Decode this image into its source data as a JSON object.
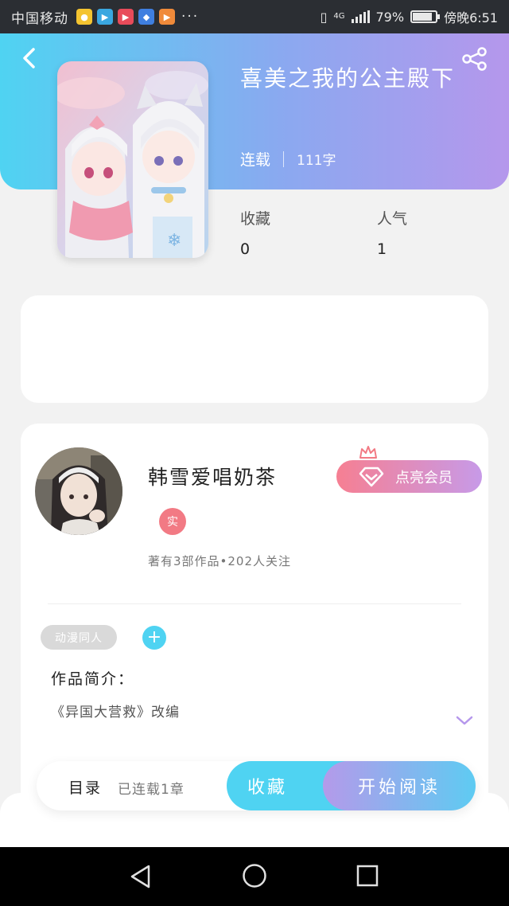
{
  "status_bar": {
    "carrier": "中国移动",
    "network": "4G",
    "battery": "79%",
    "battery_level": 0.79,
    "time": "傍晚6:51",
    "more": "···"
  },
  "book": {
    "title": "喜美之我的公主殿下",
    "status": "连载",
    "word_count": "111字",
    "stats": [
      {
        "label": "收藏",
        "value": "0"
      },
      {
        "label": "人气",
        "value": "1"
      }
    ]
  },
  "author": {
    "name": "韩雪爱唱奶茶",
    "badge": "实",
    "summary": "著有3部作品•202人关注",
    "vip_button": "点亮会员"
  },
  "tags": [
    "动漫同人"
  ],
  "add_tag_label": "+",
  "intro": {
    "label": "作品简介：",
    "text": "《异国大营救》改编"
  },
  "bottom_bar": {
    "toc_label": "目录",
    "toc_status": "已连载1章",
    "collect_label": "收藏",
    "read_label": "开始阅读"
  },
  "colors": {
    "accent_cyan": "#4fd3f2",
    "accent_purple": "#b597ec",
    "vip_pink": "#f67f92",
    "badge_red": "#f27a84"
  }
}
